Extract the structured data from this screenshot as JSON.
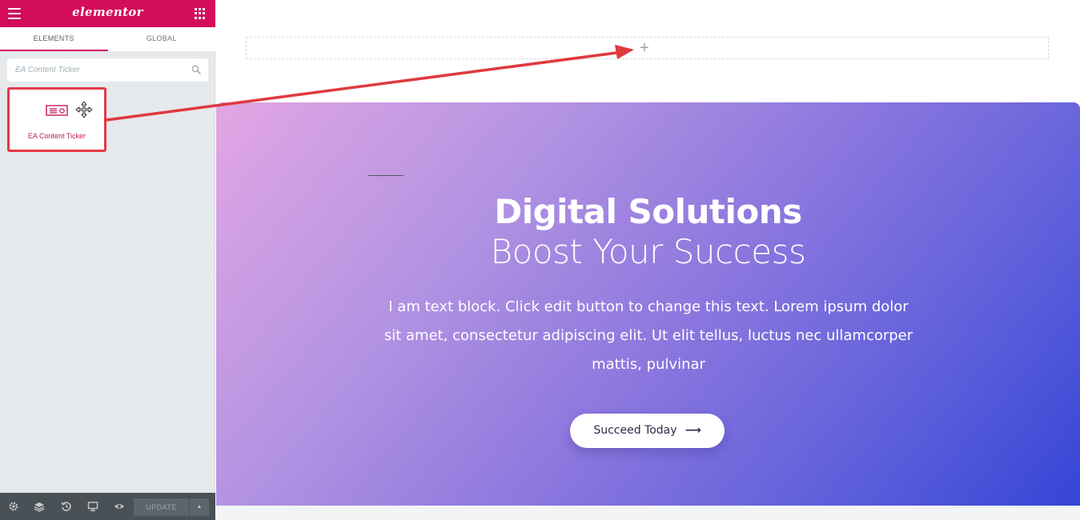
{
  "app": {
    "logo_text": "elementor"
  },
  "sidebar": {
    "tabs": [
      {
        "label": "ELEMENTS",
        "active": true
      },
      {
        "label": "GLOBAL",
        "active": false
      }
    ],
    "search": {
      "placeholder": "EA Content Ticker",
      "value": ""
    },
    "widgets": [
      {
        "label": "EA Content Ticker",
        "icon": "content-ticker-icon"
      }
    ],
    "footer": {
      "icons": [
        "settings-icon",
        "layers-icon",
        "history-icon",
        "responsive-icon",
        "preview-icon"
      ],
      "update_label": "UPDATE",
      "update_arrow": "▲"
    },
    "collapse_glyph": "‹"
  },
  "canvas": {
    "add_section_glyph": "+",
    "hero": {
      "title": "Digital Solutions",
      "subtitle": "Boost Your Success",
      "text": "I am text block. Click edit button to change this text. Lorem ipsum dolor sit amet, consectetur adipiscing elit. Ut elit tellus, luctus nec ullamcorper mattis, pulvinar",
      "button_label": "Succeed Today",
      "button_arrow": "⟶"
    }
  },
  "colors": {
    "brand": "#d30c5c",
    "highlight": "#e63946",
    "annotation_arrow": "#e0393e",
    "gradient_start": "#e3a6e4",
    "gradient_end": "#3545d6"
  }
}
